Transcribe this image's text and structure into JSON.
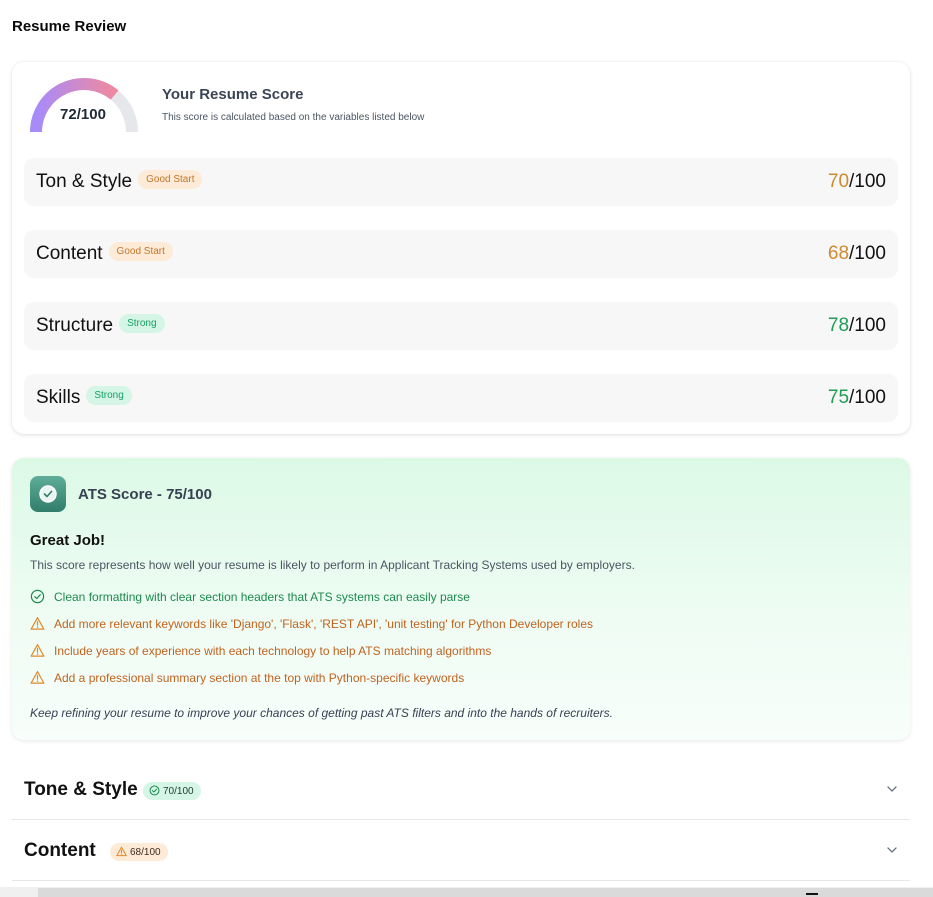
{
  "page": {
    "title": "Resume Review"
  },
  "score_card": {
    "gauge_label": "72/100",
    "gauge_value": 72,
    "title": "Your Resume Score",
    "subtitle": "This score is calculated based on the variables listed below",
    "categories": [
      {
        "name": "Ton & Style",
        "badge": "Good Start",
        "badge_tone": "warn",
        "score": "70",
        "max": "/100"
      },
      {
        "name": "Content",
        "badge": "Good Start",
        "badge_tone": "warn",
        "score": "68",
        "max": "/100"
      },
      {
        "name": "Structure",
        "badge": "Strong",
        "badge_tone": "good",
        "score": "78",
        "max": "/100"
      },
      {
        "name": "Skills",
        "badge": "Strong",
        "badge_tone": "good",
        "score": "75",
        "max": "/100"
      }
    ]
  },
  "ats": {
    "icon": "check-shield-icon",
    "title": "ATS Score - 75/100",
    "headline": "Great Job!",
    "description": "This score represents how well your resume is likely to perform in Applicant Tracking Systems used by employers.",
    "items": [
      {
        "type": "pass",
        "icon": "check-circle-icon",
        "text": "Clean formatting with clear section headers that ATS systems can easily parse"
      },
      {
        "type": "warn",
        "icon": "warning-triangle-icon",
        "text": "Add more relevant keywords like 'Django', 'Flask', 'REST API', 'unit testing' for Python Developer roles"
      },
      {
        "type": "warn",
        "icon": "warning-triangle-icon",
        "text": "Include years of experience with each technology to help ATS matching algorithms"
      },
      {
        "type": "warn",
        "icon": "warning-triangle-icon",
        "text": "Add a professional summary section at the top with Python-specific keywords"
      }
    ],
    "footer": "Keep refining your resume to improve your chances of getting past ATS filters and into the hands of recruiters."
  },
  "sections": [
    {
      "title": "Tone & Style",
      "badge": "70/100",
      "tone": "good",
      "icon": "check-circle-icon"
    },
    {
      "title": "Content",
      "badge": "68/100",
      "tone": "warn",
      "icon": "warning-triangle-icon"
    }
  ],
  "colors": {
    "warn": "#d08a2e",
    "good": "#1f9d55",
    "ats_bg": "#dcf9e6",
    "gauge_start": "#a78bfa",
    "gauge_end": "#f0899f"
  }
}
